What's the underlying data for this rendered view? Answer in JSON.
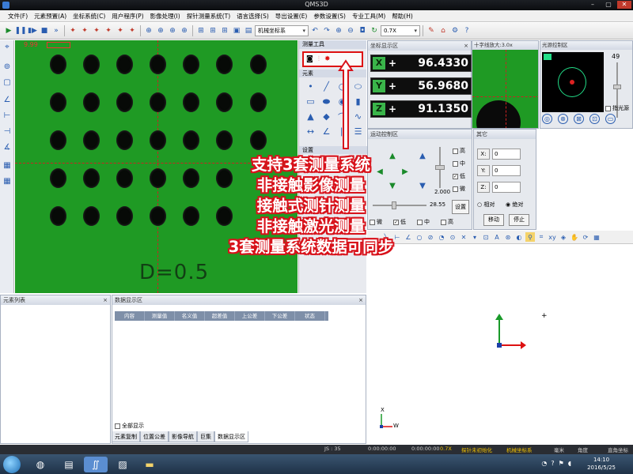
{
  "window": {
    "title": "QMS3D"
  },
  "menu": [
    "文件(F)",
    "元素预置(A)",
    "坐标系统(C)",
    "用户程序(P)",
    "影像处理(I)",
    "探针测量系统(T)",
    "语言选择(S)",
    "导出设置(E)",
    "参数设置(S)",
    "专业工具(M)",
    "帮助(H)"
  ],
  "toolbar": {
    "coord_system": "机械坐标系",
    "zoom": "0.7X"
  },
  "camera": {
    "overlay_zoom": "9.99",
    "part_label": "D=0.5"
  },
  "measure_tool": {
    "title": "测量工具",
    "elements_label": "元素",
    "options_label": "设置"
  },
  "coord_panel": {
    "title": "坐标显示区",
    "axes": [
      {
        "axis": "X",
        "sign": "+",
        "value": "96.4330",
        "btn": "X/0"
      },
      {
        "axis": "Y",
        "sign": "+",
        "value": "56.9680",
        "btn": "Y/0"
      },
      {
        "axis": "Z",
        "sign": "+",
        "value": "91.1350",
        "btn": "Z/0"
      }
    ]
  },
  "crosshair_panel": {
    "title": "十字线放大:3.0x"
  },
  "light_panel": {
    "title": "光源控制区",
    "level": "49",
    "pointer_label": "指光源"
  },
  "motion_panel": {
    "title": "运动控制区",
    "step_value": "2.000",
    "speed_value": "28.55",
    "speed_levels": [
      "高",
      "中",
      "低",
      "微"
    ],
    "bottom_opts": [
      "微",
      "低",
      "中",
      "高"
    ],
    "settings_btn": "设置"
  },
  "other_panel": {
    "title": "其它",
    "fields": [
      {
        "label": "X:",
        "value": "0"
      },
      {
        "label": "Y:",
        "value": "0"
      },
      {
        "label": "Z:",
        "value": "0"
      }
    ],
    "relative": "相对",
    "absolute": "绝对",
    "move_btn": "移动",
    "stop_btn": "停止"
  },
  "caption": [
    "支持3套测量系统",
    "非接触影像测量",
    "接触式测针测量",
    "非接触激光测量",
    "3套测量系统数据可同步"
  ],
  "element_list": {
    "title": "元素列表"
  },
  "data_panel": {
    "title": "数据显示区",
    "columns": [
      "内容",
      "测量值",
      "名义值",
      "超差值",
      "上公差",
      "下公差",
      "状态"
    ],
    "show_all": "全部显示"
  },
  "bottom_tabs": [
    "元素复制",
    "位置公差",
    "影像导航",
    "巨集",
    "数据显示区"
  ],
  "status": {
    "js": "JS : 35",
    "t1": "0:00:00:00",
    "t2": "0:00:00:00",
    "zoom": "0.7X",
    "probe": "探针未初始化",
    "coord": "机械坐标系",
    "unit": "毫米",
    "angle": "角度",
    "rect": "直角坐标"
  },
  "taskbar": {
    "time": "14:10",
    "date": "2016/5/25"
  },
  "view3d": {
    "axis_x": "X",
    "axis_w": "W"
  },
  "colors": {
    "camera_green": "#1f9a24",
    "caption_red": "#d8121b",
    "coord_bg": "#0e0e0e",
    "axis_green": "#3ab54a"
  }
}
